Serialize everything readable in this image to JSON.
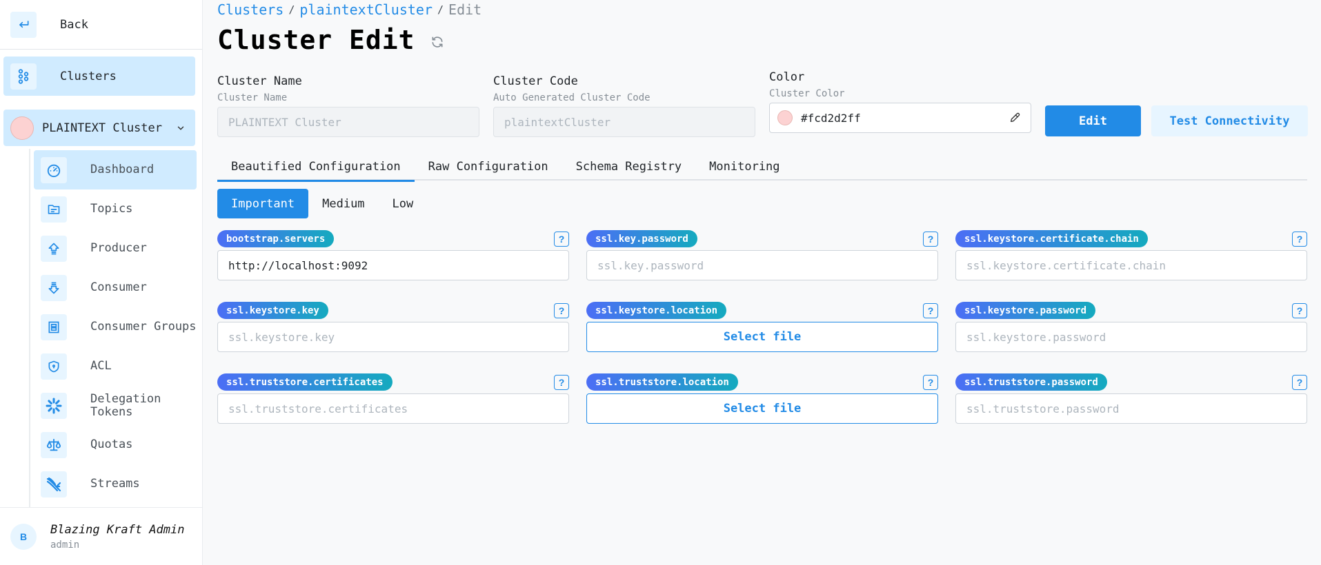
{
  "sidebar": {
    "back_label": "Back",
    "clusters_label": "Clusters",
    "cluster_name": "PLAINTEXT Cluster",
    "cluster_color": "#fcd2d2",
    "items": [
      {
        "label": "Dashboard",
        "icon": "dashboard-icon",
        "active": true
      },
      {
        "label": "Topics",
        "icon": "topics-icon"
      },
      {
        "label": "Producer",
        "icon": "producer-icon"
      },
      {
        "label": "Consumer",
        "icon": "consumer-icon"
      },
      {
        "label": "Consumer Groups",
        "icon": "consumer-groups-icon"
      },
      {
        "label": "ACL",
        "icon": "shield-icon"
      },
      {
        "label": "Delegation Tokens",
        "icon": "delegation-icon"
      },
      {
        "label": "Quotas",
        "icon": "scale-icon"
      },
      {
        "label": "Streams",
        "icon": "streams-icon"
      }
    ],
    "user": {
      "initial": "B",
      "name": "Blazing Kraft Admin",
      "role": "admin"
    }
  },
  "breadcrumb": {
    "items": [
      "Clusters",
      "plaintextCluster"
    ],
    "current": "Edit",
    "separator": "/"
  },
  "page": {
    "title": "Cluster Edit"
  },
  "form": {
    "name": {
      "label": "Cluster Name",
      "description": "Cluster Name",
      "placeholder": "PLAINTEXT Cluster"
    },
    "code": {
      "label": "Cluster Code",
      "description": "Auto Generated Cluster Code",
      "placeholder": "plaintextCluster"
    },
    "color": {
      "label": "Color",
      "description": "Cluster Color",
      "value": "#fcd2d2ff"
    },
    "edit_label": "Edit",
    "test_label": "Test Connectivity"
  },
  "tabs": [
    {
      "label": "Beautified Configuration",
      "active": true
    },
    {
      "label": "Raw Configuration"
    },
    {
      "label": "Schema Registry"
    },
    {
      "label": "Monitoring"
    }
  ],
  "subtabs": [
    {
      "label": "Important",
      "active": true
    },
    {
      "label": "Medium"
    },
    {
      "label": "Low"
    }
  ],
  "config": [
    {
      "key": "bootstrap.servers",
      "type": "text",
      "value": "http://localhost:9092",
      "placeholder": ""
    },
    {
      "key": "ssl.key.password",
      "type": "text",
      "value": "",
      "placeholder": "ssl.key.password"
    },
    {
      "key": "ssl.keystore.certificate.chain",
      "type": "text",
      "value": "",
      "placeholder": "ssl.keystore.certificate.chain"
    },
    {
      "key": "ssl.keystore.key",
      "type": "text",
      "value": "",
      "placeholder": "ssl.keystore.key"
    },
    {
      "key": "ssl.keystore.location",
      "type": "file",
      "button": "Select file"
    },
    {
      "key": "ssl.keystore.password",
      "type": "text",
      "value": "",
      "placeholder": "ssl.keystore.password"
    },
    {
      "key": "ssl.truststore.certificates",
      "type": "text",
      "value": "",
      "placeholder": "ssl.truststore.certificates"
    },
    {
      "key": "ssl.truststore.location",
      "type": "file",
      "button": "Select file"
    },
    {
      "key": "ssl.truststore.password",
      "type": "text",
      "value": "",
      "placeholder": "ssl.truststore.password"
    }
  ],
  "help_glyph": "?"
}
